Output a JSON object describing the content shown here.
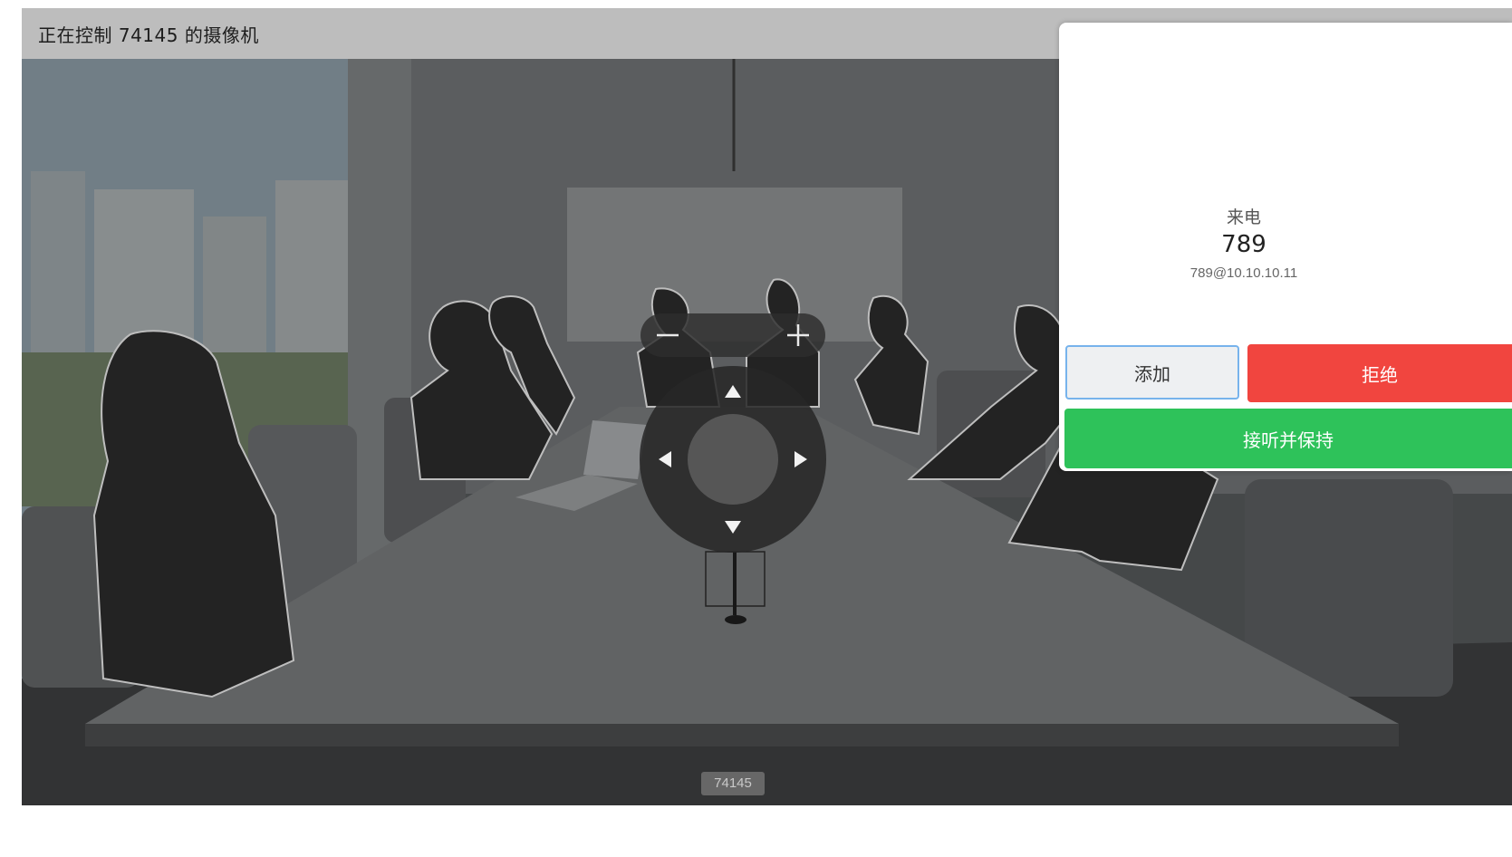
{
  "window": {
    "title": "正在控制 74145 的摄像机"
  },
  "camera": {
    "label": "74145"
  },
  "camera_controls": {
    "zoom_out_icon": "minus-icon",
    "zoom_in_icon": "plus-icon",
    "pan_icons": [
      "arrow-up-icon",
      "arrow-down-icon",
      "arrow-left-icon",
      "arrow-right-icon"
    ]
  },
  "incoming_call": {
    "type_label": "来电",
    "number": "789",
    "uri": "789@10.10.10.11",
    "add_label": "添加",
    "decline_label": "拒绝",
    "answer_hold_label": "接听并保持"
  },
  "colors": {
    "decline": "#f1453f",
    "answer": "#2ec25a",
    "add_focus_border": "#77b3ec"
  }
}
